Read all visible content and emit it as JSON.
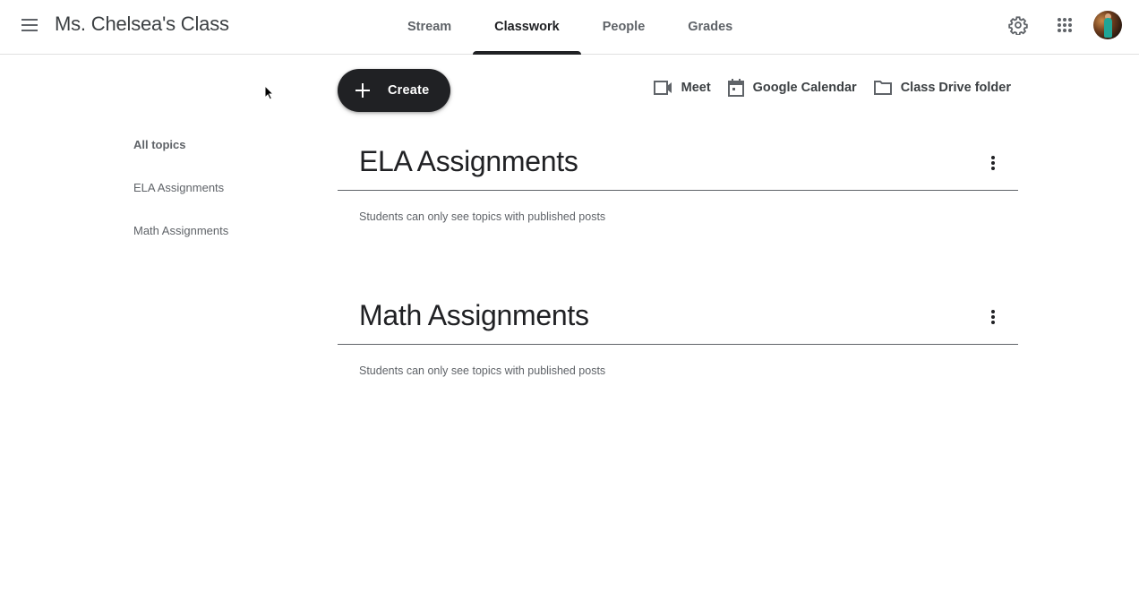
{
  "header": {
    "menu_icon": "hamburger-menu-icon",
    "class_title": "Ms. Chelsea's Class",
    "tabs": [
      {
        "label": "Stream",
        "active": false
      },
      {
        "label": "Classwork",
        "active": true
      },
      {
        "label": "People",
        "active": false
      },
      {
        "label": "Grades",
        "active": false
      }
    ],
    "settings_icon": "gear-icon",
    "apps_icon": "apps-grid-icon",
    "avatar": "user-avatar"
  },
  "toolbar": {
    "create_label": "Create",
    "links": [
      {
        "label": "Meet",
        "icon": "video-camera-icon"
      },
      {
        "label": "Google Calendar",
        "icon": "calendar-icon"
      },
      {
        "label": "Class Drive folder",
        "icon": "folder-icon"
      }
    ]
  },
  "sidebar": {
    "items": [
      {
        "label": "All topics",
        "active": true
      },
      {
        "label": "ELA Assignments",
        "active": false
      },
      {
        "label": "Math Assignments",
        "active": false
      }
    ]
  },
  "topics": [
    {
      "title": "ELA Assignments",
      "note": "Students can only see topics with published posts"
    },
    {
      "title": "Math Assignments",
      "note": "Students can only see topics with published posts"
    }
  ],
  "colors": {
    "primary_dark": "#202124",
    "text_secondary": "#5f6368",
    "divider": "#e0e0e0"
  }
}
